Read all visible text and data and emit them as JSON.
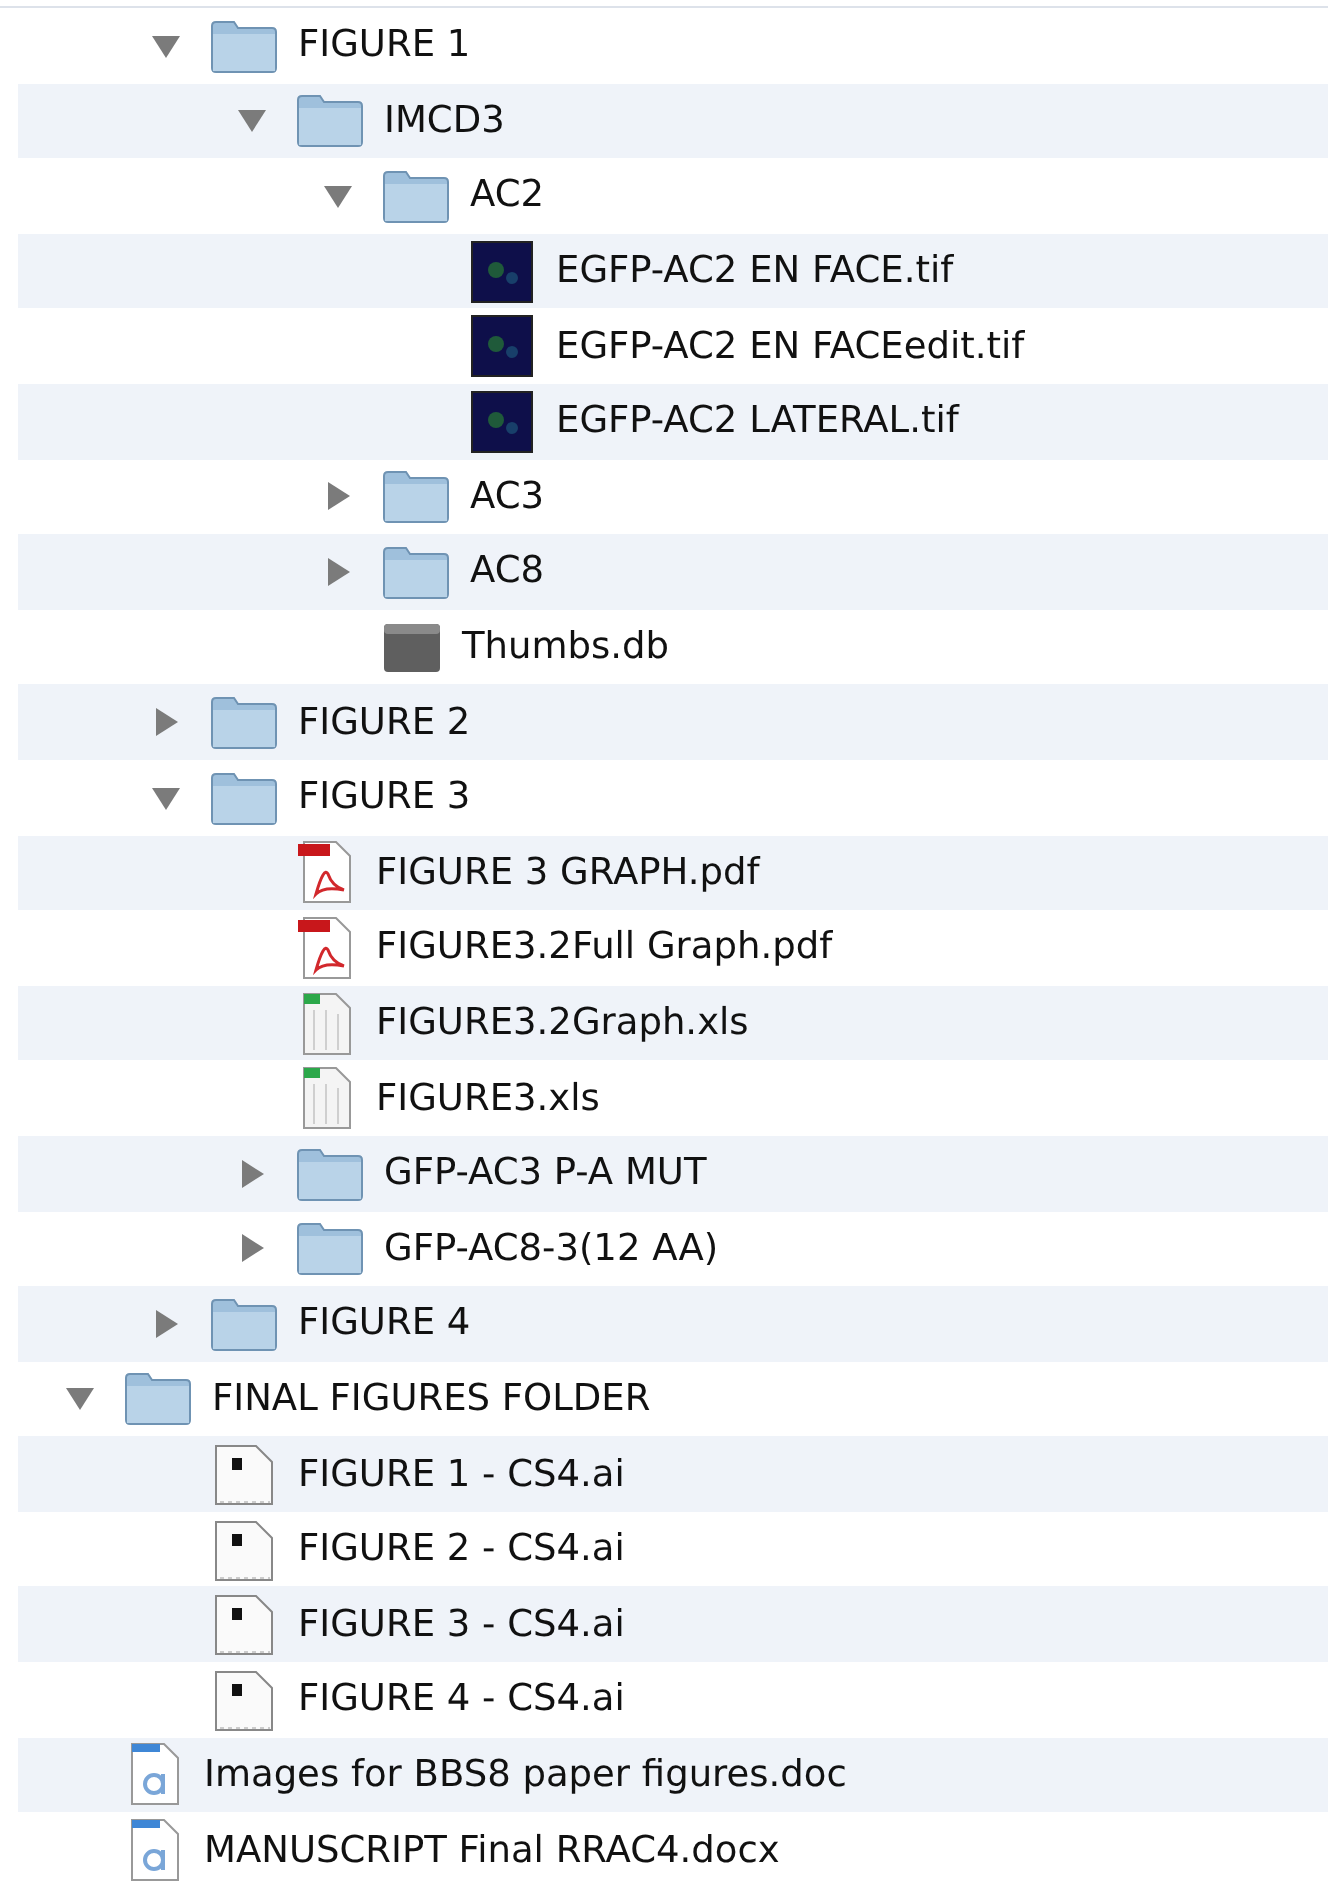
{
  "tree": [
    {
      "kind": "group",
      "children": [
        {
          "name": "FIGURE 1",
          "kind": "folder",
          "expanded": true,
          "children": [
            {
              "name": "IMCD3",
              "kind": "folder",
              "expanded": true,
              "children": [
                {
                  "name": "AC2",
                  "kind": "folder",
                  "expanded": true,
                  "children": [
                    {
                      "name": "EGFP-AC2 EN FACE.tif",
                      "kind": "tif"
                    },
                    {
                      "name": "EGFP-AC2 EN FACEedit.tif",
                      "kind": "tif"
                    },
                    {
                      "name": "EGFP-AC2 LATERAL.tif",
                      "kind": "tif"
                    }
                  ]
                },
                {
                  "name": "AC3",
                  "kind": "folder",
                  "expanded": false
                },
                {
                  "name": "AC8",
                  "kind": "folder",
                  "expanded": false
                },
                {
                  "name": "Thumbs.db",
                  "kind": "db"
                }
              ]
            }
          ]
        },
        {
          "name": "FIGURE 2",
          "kind": "folder",
          "expanded": false
        },
        {
          "name": "FIGURE 3",
          "kind": "folder",
          "expanded": true,
          "children": [
            {
              "name": "FIGURE 3 GRAPH.pdf",
              "kind": "pdf"
            },
            {
              "name": "FIGURE3.2Full Graph.pdf",
              "kind": "pdf"
            },
            {
              "name": "FIGURE3.2Graph.xls",
              "kind": "xls"
            },
            {
              "name": "FIGURE3.xls",
              "kind": "xls"
            },
            {
              "name": "GFP-AC3 P-A MUT",
              "kind": "folder",
              "expanded": false
            },
            {
              "name": "GFP-AC8-3(12 AA)",
              "kind": "folder",
              "expanded": false
            }
          ]
        },
        {
          "name": "FIGURE 4",
          "kind": "folder",
          "expanded": false
        }
      ]
    },
    {
      "name": "FINAL FIGURES FOLDER",
      "kind": "folder",
      "expanded": true,
      "children": [
        {
          "name": "FIGURE 1 - CS4.ai",
          "kind": "ai"
        },
        {
          "name": "FIGURE 2 - CS4.ai",
          "kind": "ai"
        },
        {
          "name": "FIGURE 3 - CS4.ai",
          "kind": "ai"
        },
        {
          "name": "FIGURE 4 - CS4.ai",
          "kind": "ai"
        }
      ]
    },
    {
      "name": "Images for BBS8 paper figures.doc",
      "kind": "doc"
    },
    {
      "name": "MANUSCRIPT Final RRAC4.docx",
      "kind": "doc"
    }
  ]
}
